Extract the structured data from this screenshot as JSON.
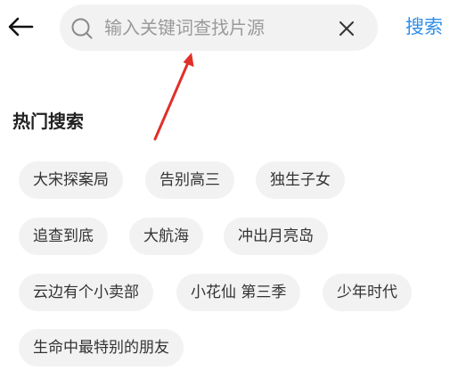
{
  "header": {
    "search": {
      "placeholder": "输入关键词查找片源",
      "value": ""
    },
    "submit_label": "搜索",
    "icons": {
      "back": "back-arrow-icon",
      "search": "search-icon",
      "clear": "close-icon"
    }
  },
  "hot_search": {
    "title": "热门搜索",
    "tags": [
      "大宋探案局",
      "告别高三",
      "独生子女",
      "追查到底",
      "大航海",
      "冲出月亮岛",
      "云边有个小卖部",
      "小花仙 第三季",
      "少年时代",
      "生命中最特别的朋友"
    ]
  },
  "colors": {
    "accent": "#2f8ee8",
    "annotation": "#e0302a",
    "chip_background": "#f2f2f2",
    "text": "#333333"
  }
}
